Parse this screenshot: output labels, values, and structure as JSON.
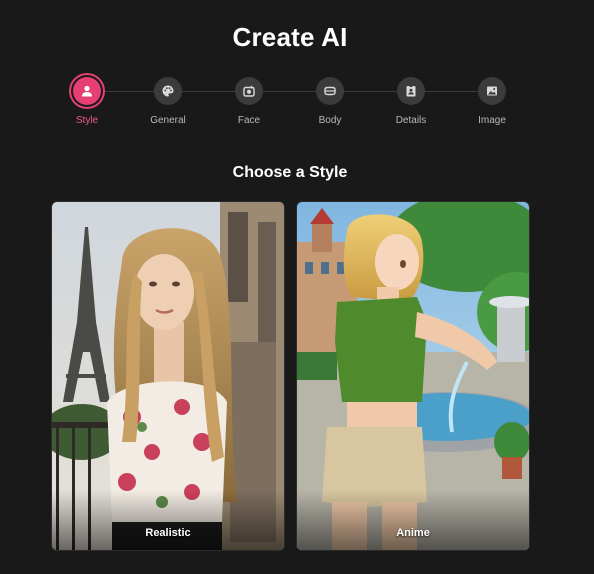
{
  "header": {
    "title": "Create AI"
  },
  "steps": [
    {
      "label": "Style",
      "icon": "person-icon",
      "active": true
    },
    {
      "label": "General",
      "icon": "palette-icon",
      "active": false
    },
    {
      "label": "Face",
      "icon": "face-camera-icon",
      "active": false
    },
    {
      "label": "Body",
      "icon": "body-icon",
      "active": false
    },
    {
      "label": "Details",
      "icon": "badge-icon",
      "active": false
    },
    {
      "label": "Image",
      "icon": "image-icon",
      "active": false
    }
  ],
  "section": {
    "title": "Choose a Style"
  },
  "styles": [
    {
      "label": "Realistic",
      "image": "photo of blonde woman in floral top near Eiffel Tower"
    },
    {
      "label": "Anime",
      "image": "anime girl in green top beside fountain"
    }
  ],
  "colors": {
    "background": "#191919",
    "accent": "#e63f73",
    "step_inactive": "#3b3b3b"
  }
}
